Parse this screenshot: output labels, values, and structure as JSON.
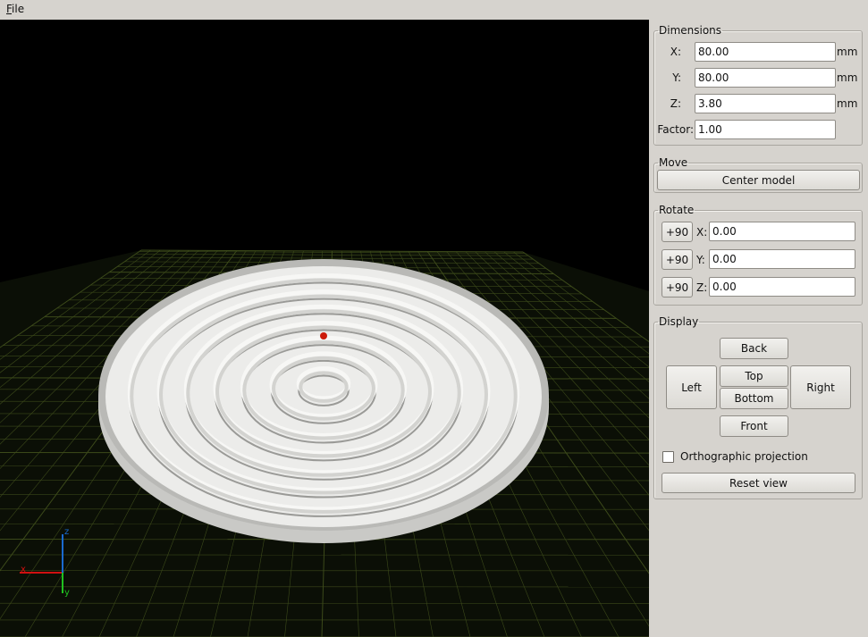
{
  "menu": {
    "file": "File"
  },
  "viewport": {
    "axes": {
      "x": "x",
      "y": "y",
      "z": "z"
    },
    "colors": {
      "background": "#000000",
      "grid": "#3c4a1a",
      "model": "#ececea",
      "marker": "#cc1a0a"
    }
  },
  "dimensions": {
    "title": "Dimensions",
    "x": {
      "label": "X:",
      "value": "80.00",
      "unit": "mm"
    },
    "y": {
      "label": "Y:",
      "value": "80.00",
      "unit": "mm"
    },
    "z": {
      "label": "Z:",
      "value": "3.80",
      "unit": "mm"
    },
    "factor": {
      "label": "Factor:",
      "value": "1.00"
    }
  },
  "move": {
    "title": "Move",
    "center_label": "Center model"
  },
  "rotate": {
    "title": "Rotate",
    "rows": [
      {
        "button": "+90",
        "axis": "X:",
        "value": "0.00"
      },
      {
        "button": "+90",
        "axis": "Y:",
        "value": "0.00"
      },
      {
        "button": "+90",
        "axis": "Z:",
        "value": "0.00"
      }
    ]
  },
  "display": {
    "title": "Display",
    "back": "Back",
    "left": "Left",
    "top": "Top",
    "bottom": "Bottom",
    "right": "Right",
    "front": "Front",
    "ortho_label": "Orthographic projection",
    "ortho_checked": false,
    "reset": "Reset view"
  }
}
